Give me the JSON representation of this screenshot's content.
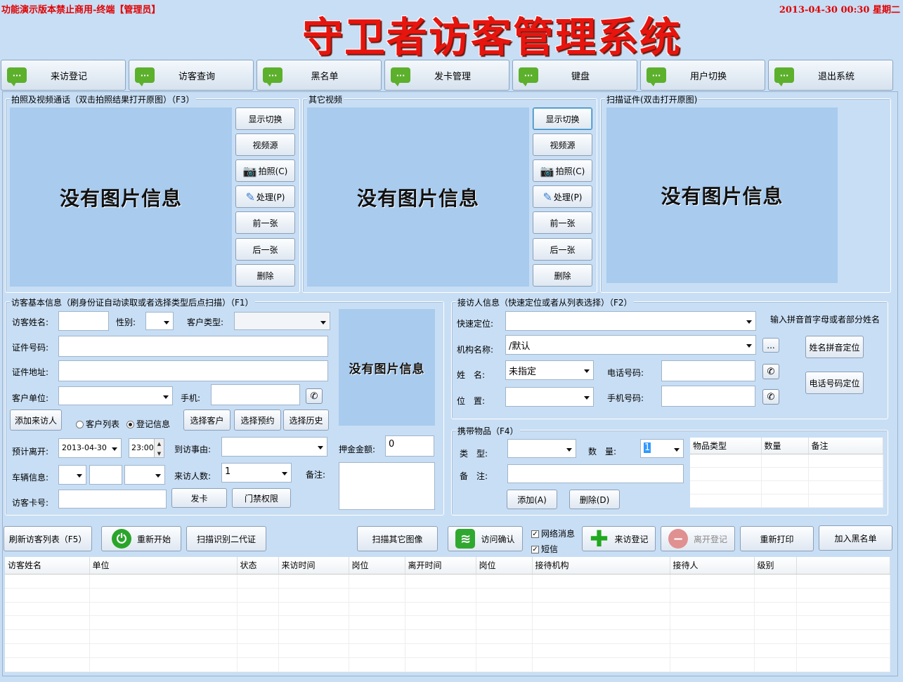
{
  "topbar": {
    "left_text": "功能演示版本禁止商用-终端【管理员】",
    "datetime": "2013-04-30 00:30 星期二"
  },
  "app_title": "守卫者访客管理系统",
  "nav": [
    {
      "label": "来访登记",
      "icon": "chat-bubble-icon"
    },
    {
      "label": "访客查询",
      "icon": "chat-bubble-icon"
    },
    {
      "label": "黑名单",
      "icon": "chat-bubble-icon"
    },
    {
      "label": "发卡管理",
      "icon": "chat-bubble-icon"
    },
    {
      "label": "键盘",
      "icon": "chat-bubble-icon"
    },
    {
      "label": "用户切换",
      "icon": "chat-bubble-icon"
    },
    {
      "label": "退出系统",
      "icon": "chat-bubble-icon"
    }
  ],
  "photo_panel": {
    "title": "拍照及视频通话（双击拍照结果打开原图）（F3）",
    "placeholder": "没有图片信息",
    "buttons": [
      "显示切换",
      "视频源",
      "拍照(C)",
      "处理(P)",
      "前一张",
      "后一张",
      "删除"
    ]
  },
  "other_video": {
    "title": "其它视频",
    "placeholder": "没有图片信息",
    "buttons": [
      "显示切换",
      "视频源",
      "拍照(C)",
      "处理(P)",
      "前一张",
      "后一张",
      "删除"
    ]
  },
  "scan_panel": {
    "title": "扫描证件(双击打开原图)",
    "placeholder": "没有图片信息"
  },
  "visitor": {
    "title": "访客基本信息（刷身份证自动读取或者选择类型后点扫描）（F1）",
    "name_label": "访客姓名:",
    "gender_label": "性别:",
    "customer_type_label": "客户类型:",
    "id_label": "证件号码:",
    "address_label": "证件地址:",
    "unit_label": "客户单位:",
    "mobile_label": "手机:",
    "add_visitor": "添加来访人",
    "radio_customer_list": "客户列表",
    "radio_register_info": "登记信息",
    "select_customer": "选择客户",
    "select_reservation": "选择预约",
    "select_history": "选择历史",
    "photo_placeholder": "没有图片信息",
    "leave_label": "预计离开:",
    "leave_date": "2013-04-30",
    "leave_time": "23:00:",
    "reason_label": "到访事由:",
    "deposit_label": "押金金额:",
    "deposit_value": "0",
    "vehicle_label": "车辆信息:",
    "count_label": "来访人数:",
    "count_value": "1",
    "remark_label": "备注:",
    "card_label": "访客卡号:",
    "issue_card": "发卡",
    "access_rights": "门禁权限"
  },
  "host": {
    "title": "接访人信息（快速定位或者从列表选择）（F2）",
    "quick_label": "快速定位:",
    "hint": "输入拼音首字母或者部分姓名",
    "org_label": "机构名称:",
    "org_value": "/默认",
    "org_browse": "...",
    "name_label": "姓　名:",
    "name_value": "未指定",
    "phone_label": "电话号码:",
    "position_label": "位　置:",
    "mobile_label": "手机号码:",
    "pinyin_locate": "姓名拼音定位",
    "phone_locate": "电话号码定位"
  },
  "items": {
    "title": "携带物品（F4）",
    "type_label": "类　型:",
    "qty_label": "数　量:",
    "qty_value": "1",
    "remark_label": "备　注:",
    "add": "添加(A)",
    "delete": "删除(D)",
    "columns": [
      "物品类型",
      "数量",
      "备注"
    ]
  },
  "actions": {
    "refresh": "刷新访客列表（F5）",
    "restart": "重新开始",
    "scan_id2": "扫描识别二代证",
    "scan_other": "扫描其它图像",
    "confirm": "访问确认",
    "net_msg": "网络消息",
    "sms": "短信",
    "register": "来访登记",
    "leave": "离开登记",
    "reprint": "重新打印",
    "blacklist": "加入黑名单"
  },
  "list": {
    "columns": [
      "访客姓名",
      "单位",
      "状态",
      "来访时间",
      "岗位",
      "离开时间",
      "岗位",
      "接待机构",
      "接待人",
      "级别"
    ]
  }
}
